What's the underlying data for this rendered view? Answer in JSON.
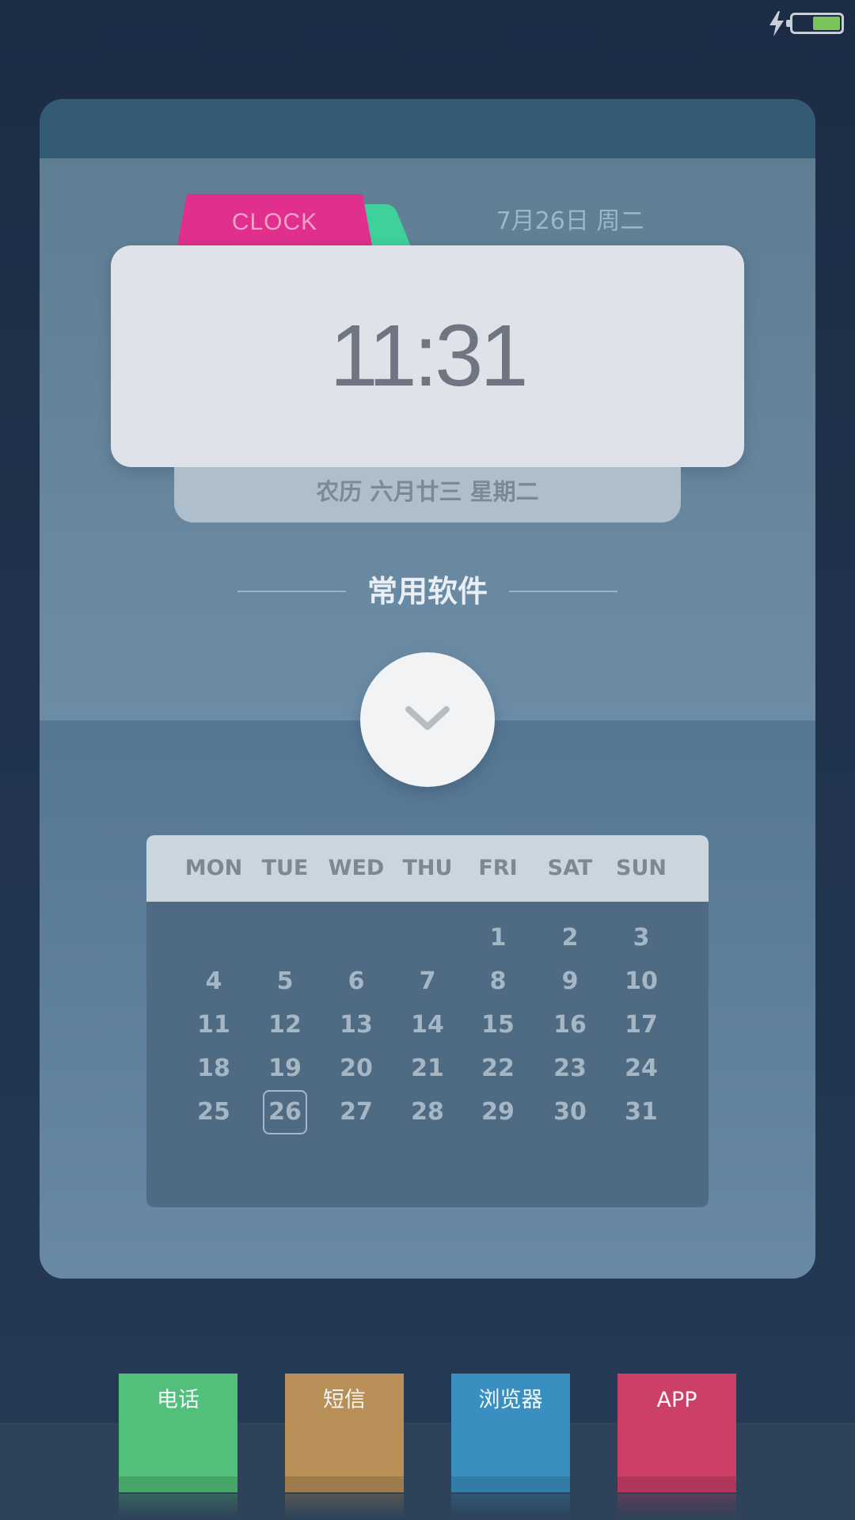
{
  "status_bar": {
    "charging": true,
    "battery_icon": "battery-icon",
    "bolt_icon": "charging-bolt-icon"
  },
  "clock_widget": {
    "tab_label": "CLOCK",
    "date": "7月26日 周二",
    "time": "11:31",
    "lunar": "农历 六月廿三  星期二"
  },
  "section": {
    "title": "常用软件"
  },
  "expand_button": {
    "icon": "chevron-down-icon"
  },
  "calendar": {
    "weekdays": [
      "MON",
      "TUE",
      "WED",
      "THU",
      "FRI",
      "SAT",
      "SUN"
    ],
    "weeks": [
      [
        "",
        "",
        "",
        "",
        "1",
        "2",
        "3"
      ],
      [
        "4",
        "5",
        "6",
        "7",
        "8",
        "9",
        "10"
      ],
      [
        "11",
        "12",
        "13",
        "14",
        "15",
        "16",
        "17"
      ],
      [
        "18",
        "19",
        "20",
        "21",
        "22",
        "23",
        "24"
      ],
      [
        "25",
        "26",
        "27",
        "28",
        "29",
        "30",
        "31"
      ]
    ],
    "today": "26"
  },
  "dock": [
    {
      "label": "电话",
      "color": "#52c07a",
      "edge": "#47a56a"
    },
    {
      "label": "短信",
      "color": "#b88f56",
      "edge": "#9e7b4a"
    },
    {
      "label": "浏览器",
      "color": "#3a8fc1",
      "edge": "#337ca7"
    },
    {
      "label": "APP",
      "color": "#cc4068",
      "edge": "#b03759"
    }
  ]
}
